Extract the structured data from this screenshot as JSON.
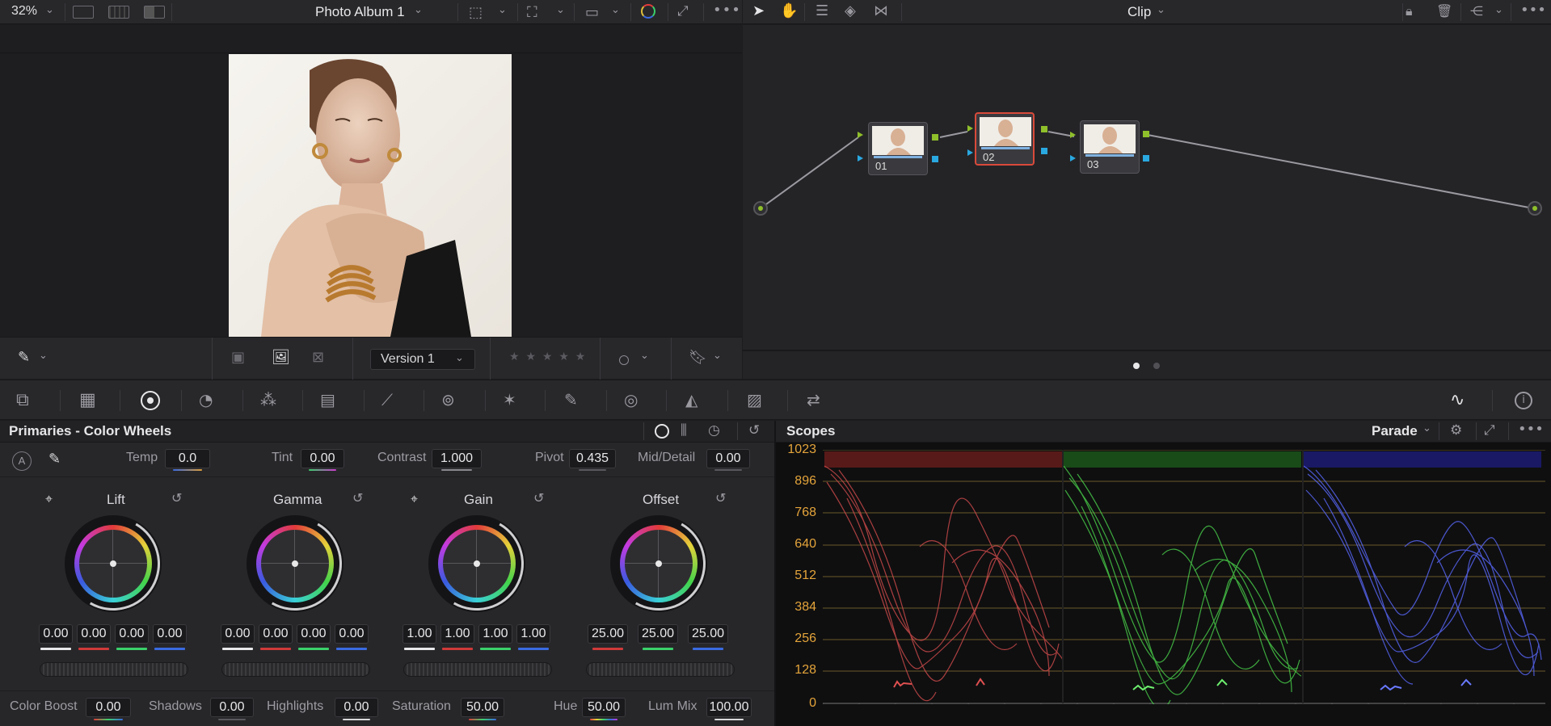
{
  "viewer_bar": {
    "zoom": "32%",
    "album_title": "Photo Album 1"
  },
  "node_bar": {
    "mode": "Clip"
  },
  "viewer_tools": {
    "version": "Version 1",
    "rating_stars": "★ ★ ★ ★ ★"
  },
  "nodes": [
    {
      "label": "01"
    },
    {
      "label": "02"
    },
    {
      "label": "03"
    }
  ],
  "primaries": {
    "title": "Primaries - Color Wheels",
    "auto_label": "A",
    "params": {
      "temp_label": "Temp",
      "temp_value": "0.0",
      "tint_label": "Tint",
      "tint_value": "0.00",
      "contrast_label": "Contrast",
      "contrast_value": "1.000",
      "pivot_label": "Pivot",
      "pivot_value": "0.435",
      "middetail_label": "Mid/Detail",
      "middetail_value": "0.00"
    },
    "wheels": [
      {
        "title": "Lift",
        "values": [
          "0.00",
          "0.00",
          "0.00",
          "0.00"
        ]
      },
      {
        "title": "Gamma",
        "values": [
          "0.00",
          "0.00",
          "0.00",
          "0.00"
        ]
      },
      {
        "title": "Gain",
        "values": [
          "1.00",
          "1.00",
          "1.00",
          "1.00"
        ]
      },
      {
        "title": "Offset",
        "values": [
          "25.00",
          "25.00",
          "25.00"
        ]
      }
    ],
    "footer": {
      "color_boost_label": "Color Boost",
      "color_boost_value": "0.00",
      "shadows_label": "Shadows",
      "shadows_value": "0.00",
      "highlights_label": "Highlights",
      "highlights_value": "0.00",
      "saturation_label": "Saturation",
      "saturation_value": "50.00",
      "hue_label": "Hue",
      "hue_value": "50.00",
      "lum_mix_label": "Lum Mix",
      "lum_mix_value": "100.00"
    }
  },
  "scopes": {
    "title": "Scopes",
    "mode": "Parade",
    "y_axis": [
      "1023",
      "896",
      "768",
      "640",
      "512",
      "384",
      "256",
      "128",
      "0"
    ]
  },
  "colors": {
    "accent_red": "#d94a3a",
    "scope_label": "#e4a43a",
    "node_connector": "#8fbf2a",
    "node_key": "#2aa8e0"
  }
}
